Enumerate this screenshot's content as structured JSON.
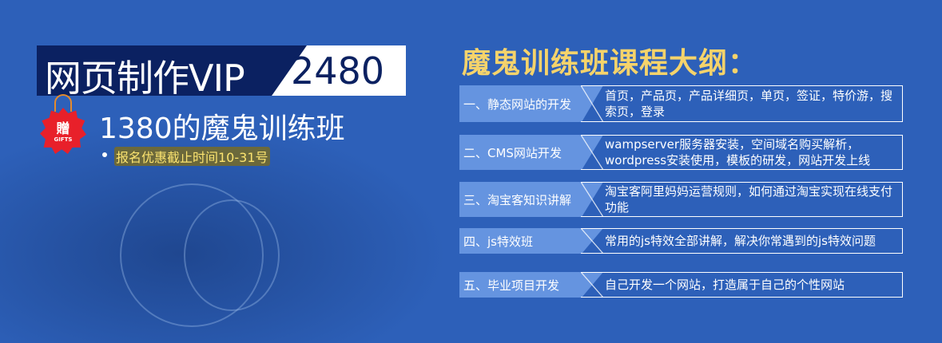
{
  "promo": {
    "title": "网页制作VIP",
    "price": "2480",
    "gift_badge": "贈",
    "gift_label": "GIFTS",
    "subtitle": "1380的魔鬼训练班",
    "deadline": "报名优惠截止时间10-31号"
  },
  "outline": {
    "title": "魔鬼训练班课程大纲：",
    "rows": [
      {
        "label": "一、静态网站的开发",
        "desc": "首页，产品页，产品详细页，单页，签证，特价游，搜索页，登录"
      },
      {
        "label": "二、CMS网站开发",
        "desc": "wampserver服务器安装，空间域名购买解析，wordpress安装使用，模板的研发，网站开发上线"
      },
      {
        "label": "三、淘宝客知识讲解",
        "desc": "淘宝客阿里妈妈运营规则，如何通过淘宝实现在线支付功能"
      },
      {
        "label": "四、js特效班",
        "desc": "常用的js特效全部讲解，解决你常遇到的js特效问题"
      },
      {
        "label": "五、毕业项目开发",
        "desc": "自己开发一个网站，打造属于自己的个性网站"
      }
    ]
  },
  "colors": {
    "background": "#2d60b9",
    "navy": "#0b2161",
    "accent_yellow": "#f5d36b",
    "label_blue": "#6594e0",
    "gift_red": "#e8202a"
  }
}
